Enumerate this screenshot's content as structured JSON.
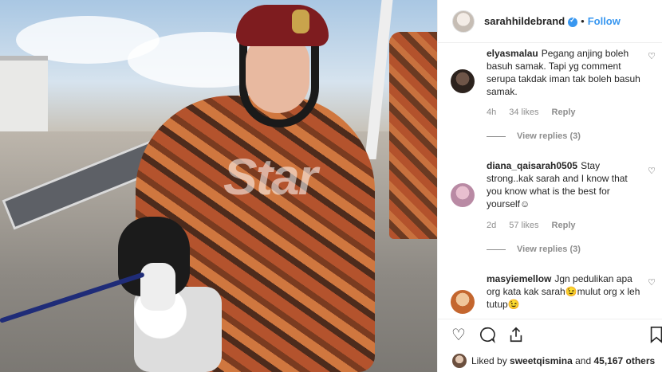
{
  "photo": {
    "watermark_text": "Star",
    "alt_description_icon": "photo"
  },
  "header": {
    "username": "sarahhildebrand",
    "separator": "•",
    "follow_label": "Follow"
  },
  "comments": [
    {
      "username": "elyasmalau",
      "text": "Pegang anjing boleh basuh samak. Tapi yg comment serupa takdak iman tak boleh basuh samak.",
      "time": "4h",
      "likes": "34 likes",
      "reply_label": "Reply",
      "view_replies": "View replies (3)"
    },
    {
      "username": "diana_qaisarah0505",
      "text": "Stay strong..kak sarah and I know that you know what is the best for yourself☺",
      "time": "2d",
      "likes": "57 likes",
      "reply_label": "Reply",
      "view_replies": "View replies (3)"
    },
    {
      "username": "masyiemellow",
      "text": "Jgn pedulikan apa org kata kak sarah😉mulut org x leh tutup😉"
    }
  ],
  "actions": {
    "like_icon": "heart-icon",
    "comment_icon": "comment-icon",
    "share_icon": "share-icon",
    "save_icon": "bookmark-icon"
  },
  "liked_by": {
    "prefix": "Liked by",
    "user": "sweetqismina",
    "middle": "and",
    "count": "45,167 others"
  },
  "colors": {
    "accent": "#3897f0",
    "text": "#262626",
    "muted": "#8e8e8e",
    "border": "#efefef"
  }
}
